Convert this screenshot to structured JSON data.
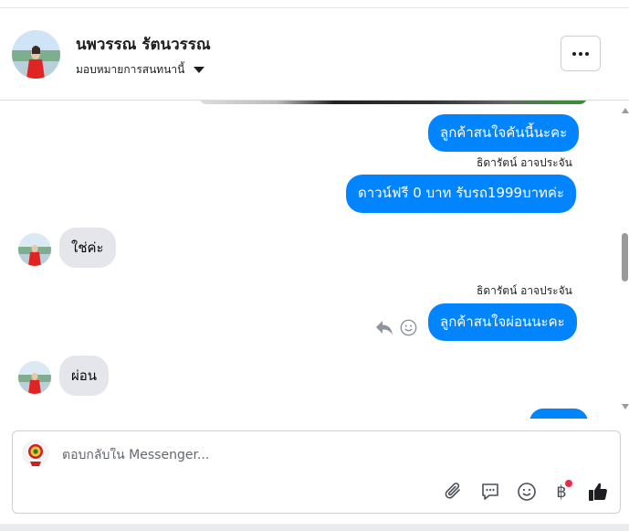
{
  "header": {
    "contact_name": "นพวรรณ รัตนวรรณ",
    "assign_label": "มอบหมายการสนทนานี้",
    "more_label": "..."
  },
  "messages": [
    {
      "direction": "outgoing",
      "text": "ลูกค้าสนใจคันนี้นะคะ"
    },
    {
      "direction": "outgoing",
      "sender": "ธิดารัตน์ อาจประจัน",
      "text": "ดาวน์ฟรี 0 บาท รับรถ1999บาทค่ะ"
    },
    {
      "direction": "incoming",
      "text": "ใช่ค่ะ"
    },
    {
      "direction": "outgoing",
      "sender": "ธิดารัตน์ อาจประจัน",
      "text": "ลูกค้าสนใจผ่อนนะคะ"
    },
    {
      "direction": "incoming",
      "text": "ผ่อน"
    }
  ],
  "composer": {
    "placeholder": "ตอบกลับใน Messenger...",
    "baht_symbol": "฿"
  },
  "colors": {
    "outgoing_bubble": "#0084ff",
    "incoming_bubble": "#e4e6eb",
    "notification_dot": "#f02849",
    "like_icon": "#1c1e21"
  },
  "icons": [
    "more-icon",
    "chevron-down-icon",
    "reply-icon",
    "emoji-icon",
    "paperclip-icon",
    "chat-bubble-icon",
    "smiley-icon",
    "baht-icon",
    "thumbs-up-icon"
  ]
}
